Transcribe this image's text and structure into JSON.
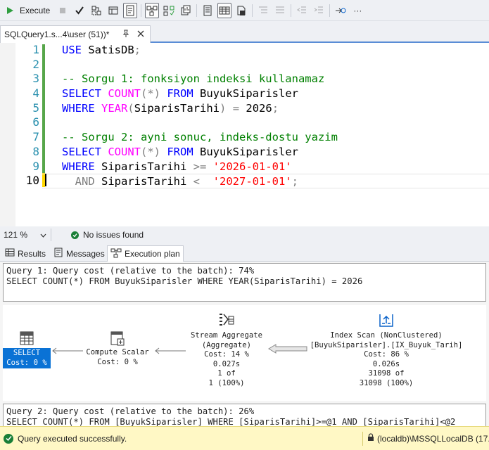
{
  "toolbar": {
    "execute_label": "Execute",
    "more_label": "···"
  },
  "document_tab": {
    "title": "SQLQuery1.s...4\\user (51))*"
  },
  "editor": {
    "line_numbers": [
      "1",
      "2",
      "3",
      "4",
      "5",
      "6",
      "7",
      "8",
      "9",
      "10"
    ],
    "current_line": "10",
    "tokens": {
      "l1_kw": "USE",
      "l1_id": " SatisDB",
      "l1_semi": ";",
      "l3_cm": "-- Sorgu 1: fonksiyon indeksi kullanamaz",
      "l4_kw1": "SELECT",
      "l4_fn": " COUNT",
      "l4_op": "(*)",
      "l4_kw2": " FROM",
      "l4_id": " BuyukSiparisler",
      "l5_kw": "WHERE",
      "l5_fn": " YEAR",
      "l5_op1": "(",
      "l5_id": "SiparisTarihi",
      "l5_op2": ")",
      "l5_op3": " =",
      "l5_num": " 2026",
      "l5_semi": ";",
      "l7_cm": "-- Sorgu 2: ayni sonuc, indeks-dostu yazim",
      "l8_kw1": "SELECT",
      "l8_fn": " COUNT",
      "l8_op": "(*)",
      "l8_kw2": " FROM",
      "l8_id": " BuyukSiparisler",
      "l9_kw": "WHERE",
      "l9_id": " SiparisTarihi",
      "l9_op": " >=",
      "l9_str": " '2026-01-01'",
      "l10_pad": "  ",
      "l10_kw": "AND",
      "l10_id": " SiparisTarihi",
      "l10_op": " <",
      "l10_str": "  '2027-01-01'",
      "l10_semi": ";"
    }
  },
  "status_row": {
    "zoom": "121 %",
    "issues": "No issues found"
  },
  "result_tabs": [
    {
      "label": "Results"
    },
    {
      "label": "Messages"
    },
    {
      "label": "Execution plan",
      "active": true
    }
  ],
  "plan": {
    "query1": {
      "header": "Query 1: Query cost (relative to the batch): 74%",
      "sql": "SELECT COUNT(*) FROM BuyukSiparisler WHERE YEAR(SiparisTarihi) = 2026"
    },
    "nodes": {
      "select": {
        "label": "SELECT",
        "cost": "Cost: 0 %"
      },
      "compute": {
        "label": "Compute Scalar",
        "cost": "Cost: 0 %"
      },
      "aggregate": {
        "label": "Stream Aggregate",
        "sub": "(Aggregate)",
        "cost": "Cost: 14 %",
        "time": "0.027s",
        "rows": "1 of",
        "est": "1 (100%)"
      },
      "scan": {
        "label": "Index Scan (NonClustered)",
        "sub": "[BuyukSiparisler].[IX_Buyuk_Tarih]",
        "cost": "Cost: 86 %",
        "time": "0.026s",
        "rows": "31098 of",
        "est": "31098 (100%)"
      }
    },
    "query2": {
      "header": "Query 2: Query cost (relative to the batch): 26%",
      "sql": "SELECT COUNT(*) FROM [BuyukSiparisler] WHERE [SiparisTarihi]>=@1 AND [SiparisTarihi]<@2"
    }
  },
  "statusbar": {
    "message": "Query executed successfully.",
    "server": "(localdb)\\MSSQLLocalDB (17..."
  }
}
